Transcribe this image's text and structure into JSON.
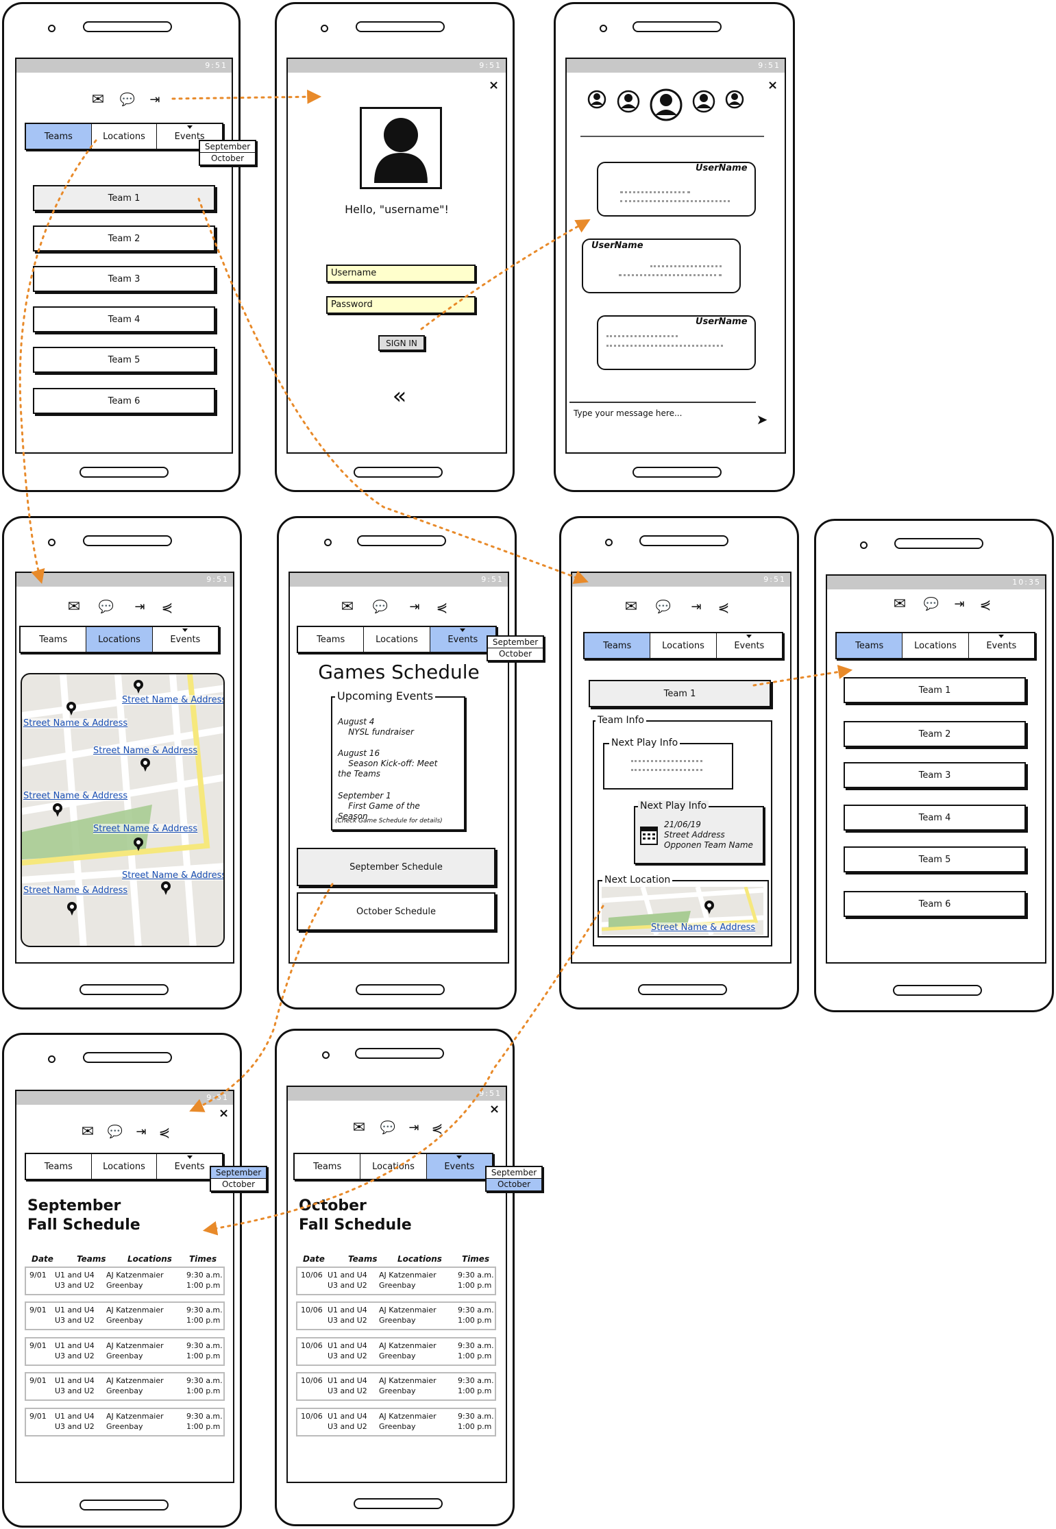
{
  "status": {
    "time": "9:51",
    "time_alt": "10:35"
  },
  "tabs": [
    "Teams",
    "Locations",
    "Events"
  ],
  "months": [
    "September",
    "October"
  ],
  "teams": [
    "Team 1",
    "Team 2",
    "Team 3",
    "Team 4",
    "Team 5",
    "Team 6"
  ],
  "login": {
    "greeting": "Hello, \"username\"!",
    "username_placeholder": "Username",
    "password_placeholder": "Password",
    "sign_in": "SIGN IN"
  },
  "chat": {
    "username": "UserName",
    "message_placeholder": "Type your message here..."
  },
  "locations": {
    "link": "Street Name & Address"
  },
  "games": {
    "title": "Games Schedule",
    "upcoming_title": "Upcoming Events",
    "events": [
      "August 4\n    NYSL fundraiser",
      "August 16\n    Season Kick-off: Meet\nthe Teams",
      "September 1\n    First Game of the\nSeason"
    ],
    "note": "(Check Game Schedule for details)",
    "september_button": "September Schedule",
    "october_button": "October Schedule"
  },
  "team_info": {
    "selected": "Team 1",
    "section": "Team Info",
    "next_play": "Next Play Info",
    "date": "21/06/19",
    "address": "Street Address",
    "opponent": "Opponen Team Name",
    "next_location": "Next Location",
    "location_link": "Street Name & Address"
  },
  "schedule": {
    "september_title": "September\nFall Schedule",
    "october_title": "October\nFall Schedule",
    "headers": [
      "Date",
      "Teams",
      "Locations",
      "Times"
    ],
    "teams": "U1 and U4\nU3 and U2",
    "location": "AJ Katzenmaier\nGreenbay",
    "times": "9:30 a.m.\n1:00 p.m",
    "september_date": "9/01",
    "october_date": "10/06"
  }
}
